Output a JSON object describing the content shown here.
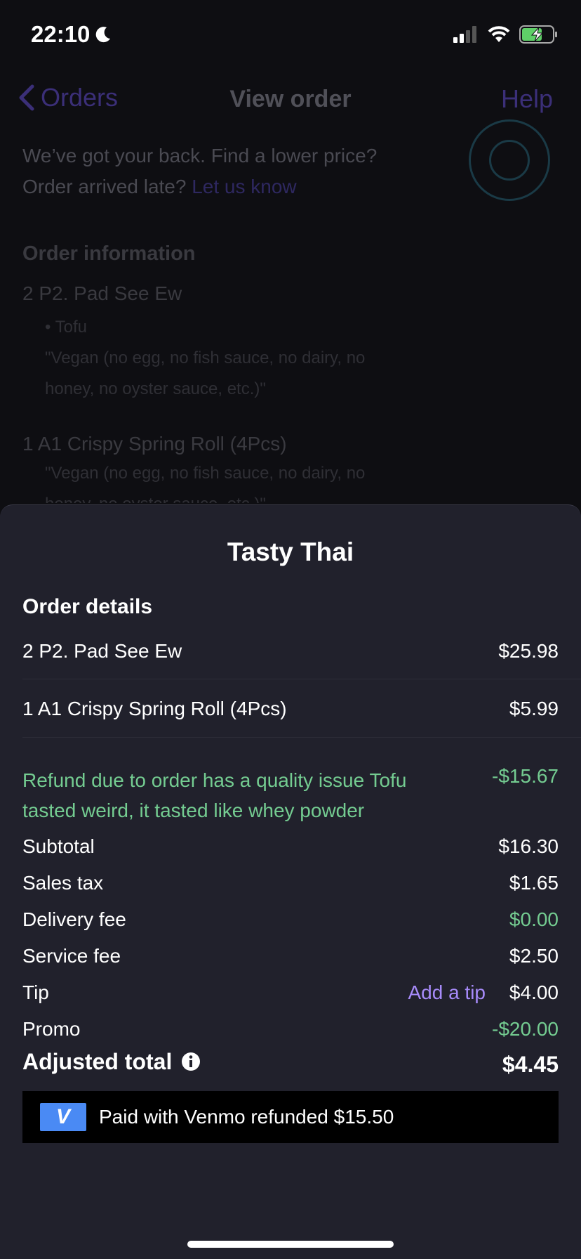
{
  "status_bar": {
    "time": "22:10"
  },
  "nav": {
    "back_label": "Orders",
    "title": "View order",
    "help": "Help"
  },
  "guarantee": {
    "line1": "We’ve got your back. Find a lower price?",
    "line2_prefix": "Order arrived late?",
    "link": "Let us know"
  },
  "order_info": {
    "heading": "Order information",
    "items": [
      {
        "name": "2 P2. Pad See Ew",
        "option": "• Tofu",
        "note": "\"Vegan (no egg, no fish sauce, no dairy, no honey, no oyster sauce, etc.)\""
      },
      {
        "name": "1 A1 Crispy Spring Roll (4Pcs)",
        "note": "\"Vegan (no egg, no fish sauce, no dairy, no honey, no oyster sauce, etc.)\""
      }
    ]
  },
  "sheet": {
    "restaurant": "Tasty Thai",
    "section": "Order details",
    "items": [
      {
        "label": "2 P2. Pad See Ew",
        "price": "$25.98"
      },
      {
        "label": "1 A1 Crispy Spring Roll (4Pcs)",
        "price": "$5.99"
      }
    ],
    "refund": {
      "label": "Refund due to order has a quality issue Tofu tasted weird, it tasted like whey powder",
      "amount": "-$15.67"
    },
    "subtotal": {
      "label": "Subtotal",
      "value": "$16.30"
    },
    "sales_tax": {
      "label": "Sales tax",
      "value": "$1.65"
    },
    "delivery_fee": {
      "label": "Delivery fee",
      "value": "$0.00"
    },
    "service_fee": {
      "label": "Service fee",
      "value": "$2.50"
    },
    "tip": {
      "label": "Tip",
      "action": "Add a tip",
      "value": "$4.00"
    },
    "promo": {
      "label": "Promo",
      "value": "-$20.00"
    },
    "adjusted_total": {
      "label": "Adjusted total",
      "value": "$4.45"
    },
    "payment": {
      "logo": "V",
      "text": "Paid with Venmo refunded $15.50"
    }
  },
  "colors": {
    "green": "#74cc91",
    "purple": "#a78bfa",
    "sheet_bg": "#21212c",
    "venmo_blue": "#4a8af4"
  },
  "icons": [
    "moon-icon",
    "signal-icon",
    "wifi-icon",
    "battery-charging-icon",
    "chevron-left-icon",
    "guarantee-badge-icon",
    "info-icon",
    "venmo-logo"
  ]
}
